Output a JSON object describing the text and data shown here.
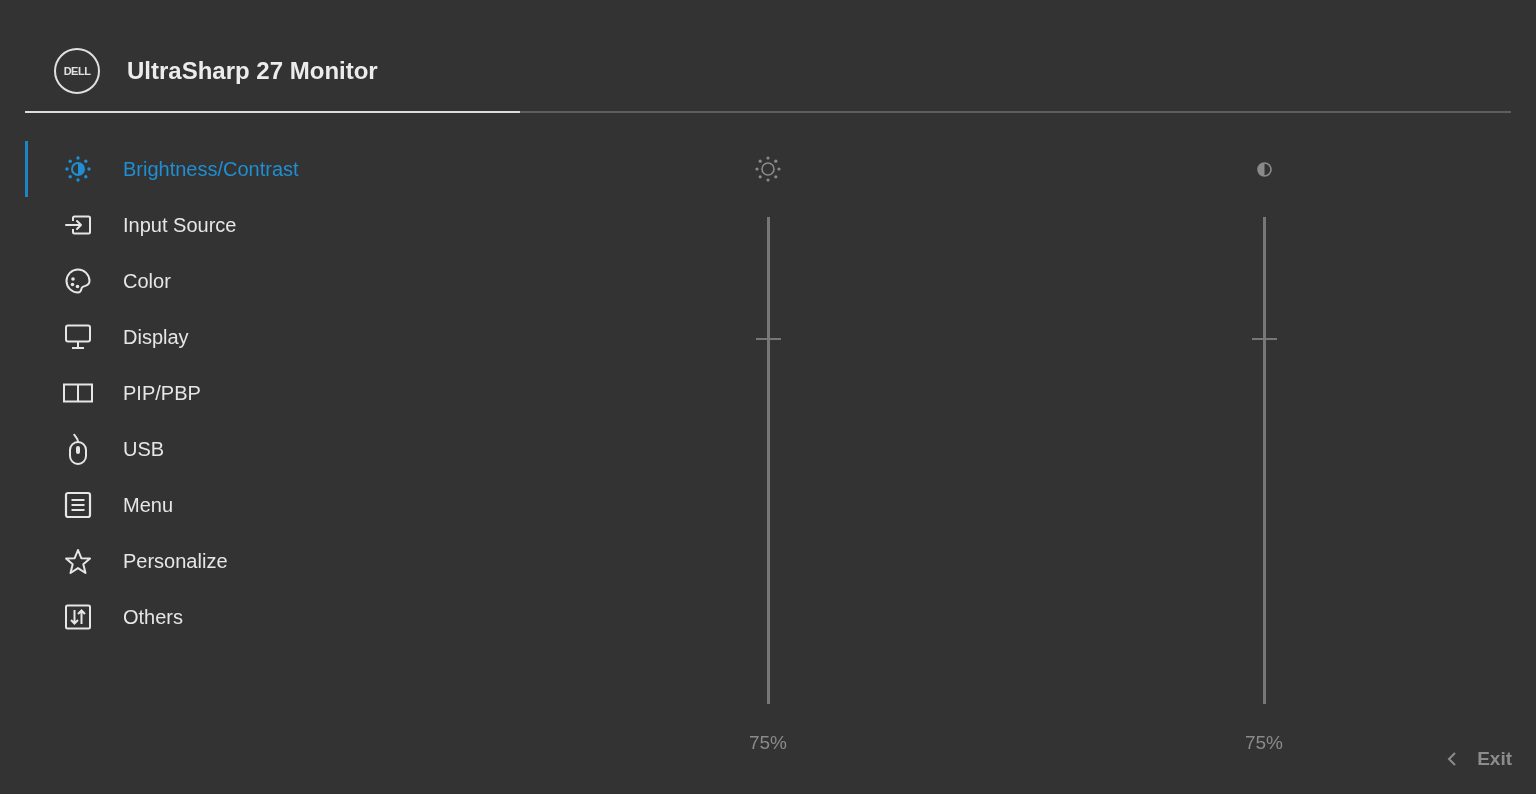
{
  "header": {
    "logo_text": "DELL",
    "title": "UltraSharp 27 Monitor"
  },
  "menu": [
    {
      "label": "Brightness/Contrast",
      "selected": true
    },
    {
      "label": "Input Source",
      "selected": false
    },
    {
      "label": "Color",
      "selected": false
    },
    {
      "label": "Display",
      "selected": false
    },
    {
      "label": "PIP/PBP",
      "selected": false
    },
    {
      "label": "USB",
      "selected": false
    },
    {
      "label": "Menu",
      "selected": false
    },
    {
      "label": "Personalize",
      "selected": false
    },
    {
      "label": "Others",
      "selected": false
    }
  ],
  "sliders": [
    {
      "level": 0.75,
      "reading": "75%"
    },
    {
      "level": 0.75,
      "reading": "75%"
    }
  ],
  "exit": {
    "label": "Exit"
  }
}
